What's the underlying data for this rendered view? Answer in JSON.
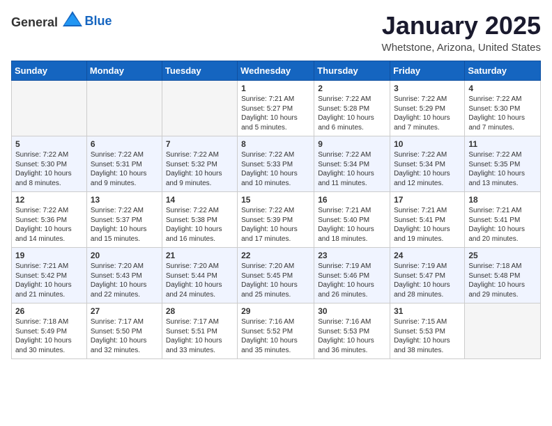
{
  "header": {
    "logo_general": "General",
    "logo_blue": "Blue",
    "title": "January 2025",
    "subtitle": "Whetstone, Arizona, United States"
  },
  "days_of_week": [
    "Sunday",
    "Monday",
    "Tuesday",
    "Wednesday",
    "Thursday",
    "Friday",
    "Saturday"
  ],
  "weeks": [
    [
      {
        "day": "",
        "info": ""
      },
      {
        "day": "",
        "info": ""
      },
      {
        "day": "",
        "info": ""
      },
      {
        "day": "1",
        "info": "Sunrise: 7:21 AM\nSunset: 5:27 PM\nDaylight: 10 hours\nand 5 minutes."
      },
      {
        "day": "2",
        "info": "Sunrise: 7:22 AM\nSunset: 5:28 PM\nDaylight: 10 hours\nand 6 minutes."
      },
      {
        "day": "3",
        "info": "Sunrise: 7:22 AM\nSunset: 5:29 PM\nDaylight: 10 hours\nand 7 minutes."
      },
      {
        "day": "4",
        "info": "Sunrise: 7:22 AM\nSunset: 5:30 PM\nDaylight: 10 hours\nand 7 minutes."
      }
    ],
    [
      {
        "day": "5",
        "info": "Sunrise: 7:22 AM\nSunset: 5:30 PM\nDaylight: 10 hours\nand 8 minutes."
      },
      {
        "day": "6",
        "info": "Sunrise: 7:22 AM\nSunset: 5:31 PM\nDaylight: 10 hours\nand 9 minutes."
      },
      {
        "day": "7",
        "info": "Sunrise: 7:22 AM\nSunset: 5:32 PM\nDaylight: 10 hours\nand 9 minutes."
      },
      {
        "day": "8",
        "info": "Sunrise: 7:22 AM\nSunset: 5:33 PM\nDaylight: 10 hours\nand 10 minutes."
      },
      {
        "day": "9",
        "info": "Sunrise: 7:22 AM\nSunset: 5:34 PM\nDaylight: 10 hours\nand 11 minutes."
      },
      {
        "day": "10",
        "info": "Sunrise: 7:22 AM\nSunset: 5:34 PM\nDaylight: 10 hours\nand 12 minutes."
      },
      {
        "day": "11",
        "info": "Sunrise: 7:22 AM\nSunset: 5:35 PM\nDaylight: 10 hours\nand 13 minutes."
      }
    ],
    [
      {
        "day": "12",
        "info": "Sunrise: 7:22 AM\nSunset: 5:36 PM\nDaylight: 10 hours\nand 14 minutes."
      },
      {
        "day": "13",
        "info": "Sunrise: 7:22 AM\nSunset: 5:37 PM\nDaylight: 10 hours\nand 15 minutes."
      },
      {
        "day": "14",
        "info": "Sunrise: 7:22 AM\nSunset: 5:38 PM\nDaylight: 10 hours\nand 16 minutes."
      },
      {
        "day": "15",
        "info": "Sunrise: 7:22 AM\nSunset: 5:39 PM\nDaylight: 10 hours\nand 17 minutes."
      },
      {
        "day": "16",
        "info": "Sunrise: 7:21 AM\nSunset: 5:40 PM\nDaylight: 10 hours\nand 18 minutes."
      },
      {
        "day": "17",
        "info": "Sunrise: 7:21 AM\nSunset: 5:41 PM\nDaylight: 10 hours\nand 19 minutes."
      },
      {
        "day": "18",
        "info": "Sunrise: 7:21 AM\nSunset: 5:41 PM\nDaylight: 10 hours\nand 20 minutes."
      }
    ],
    [
      {
        "day": "19",
        "info": "Sunrise: 7:21 AM\nSunset: 5:42 PM\nDaylight: 10 hours\nand 21 minutes."
      },
      {
        "day": "20",
        "info": "Sunrise: 7:20 AM\nSunset: 5:43 PM\nDaylight: 10 hours\nand 22 minutes."
      },
      {
        "day": "21",
        "info": "Sunrise: 7:20 AM\nSunset: 5:44 PM\nDaylight: 10 hours\nand 24 minutes."
      },
      {
        "day": "22",
        "info": "Sunrise: 7:20 AM\nSunset: 5:45 PM\nDaylight: 10 hours\nand 25 minutes."
      },
      {
        "day": "23",
        "info": "Sunrise: 7:19 AM\nSunset: 5:46 PM\nDaylight: 10 hours\nand 26 minutes."
      },
      {
        "day": "24",
        "info": "Sunrise: 7:19 AM\nSunset: 5:47 PM\nDaylight: 10 hours\nand 28 minutes."
      },
      {
        "day": "25",
        "info": "Sunrise: 7:18 AM\nSunset: 5:48 PM\nDaylight: 10 hours\nand 29 minutes."
      }
    ],
    [
      {
        "day": "26",
        "info": "Sunrise: 7:18 AM\nSunset: 5:49 PM\nDaylight: 10 hours\nand 30 minutes."
      },
      {
        "day": "27",
        "info": "Sunrise: 7:17 AM\nSunset: 5:50 PM\nDaylight: 10 hours\nand 32 minutes."
      },
      {
        "day": "28",
        "info": "Sunrise: 7:17 AM\nSunset: 5:51 PM\nDaylight: 10 hours\nand 33 minutes."
      },
      {
        "day": "29",
        "info": "Sunrise: 7:16 AM\nSunset: 5:52 PM\nDaylight: 10 hours\nand 35 minutes."
      },
      {
        "day": "30",
        "info": "Sunrise: 7:16 AM\nSunset: 5:53 PM\nDaylight: 10 hours\nand 36 minutes."
      },
      {
        "day": "31",
        "info": "Sunrise: 7:15 AM\nSunset: 5:53 PM\nDaylight: 10 hours\nand 38 minutes."
      },
      {
        "day": "",
        "info": ""
      }
    ]
  ]
}
